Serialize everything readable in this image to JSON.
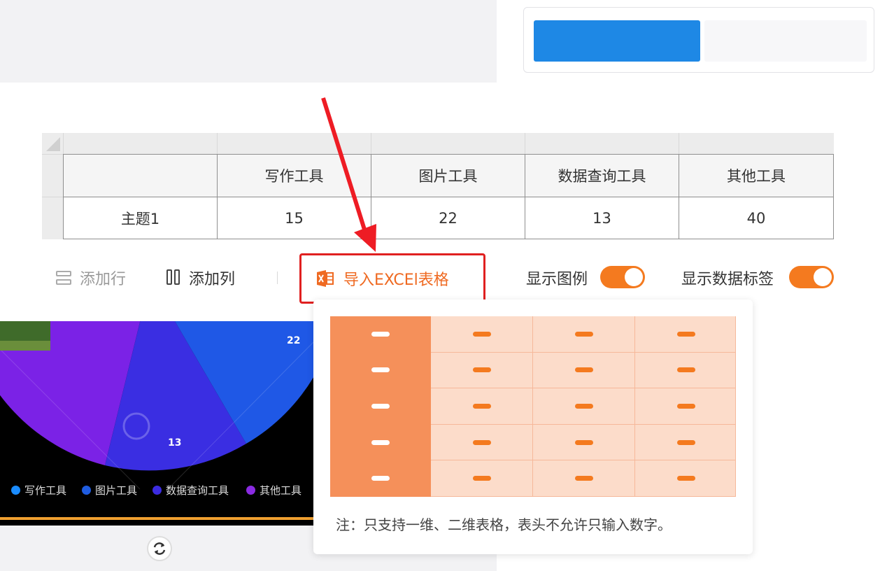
{
  "sheet": {
    "columns": [
      "",
      "写作工具",
      "图片工具",
      "数据查询工具",
      "其他工具"
    ],
    "rows": [
      {
        "label": "主题1",
        "values": [
          "15",
          "22",
          "13",
          "40"
        ]
      }
    ]
  },
  "toolbar": {
    "add_row": "添加行",
    "add_col": "添加列",
    "import_excel": "导入EXCEl表格",
    "show_legend": "显示图例",
    "show_data_labels": "显示数据标签"
  },
  "chart": {
    "data_labels": [
      "22",
      "13"
    ],
    "legend": [
      "写作工具",
      "图片工具",
      "数据查询工具",
      "其他工具"
    ],
    "colors": {
      "writing": "#1a8cff",
      "image": "#1f5ce0",
      "query": "#3b2be0",
      "other": "#8a2be2"
    }
  },
  "popup": {
    "note": "注：只支持一维、二维表格，表头不允许只输入数字。"
  },
  "colors": {
    "accent": "#f47a1f",
    "primary": "#1e88e5",
    "highlight_border": "#e02020"
  }
}
